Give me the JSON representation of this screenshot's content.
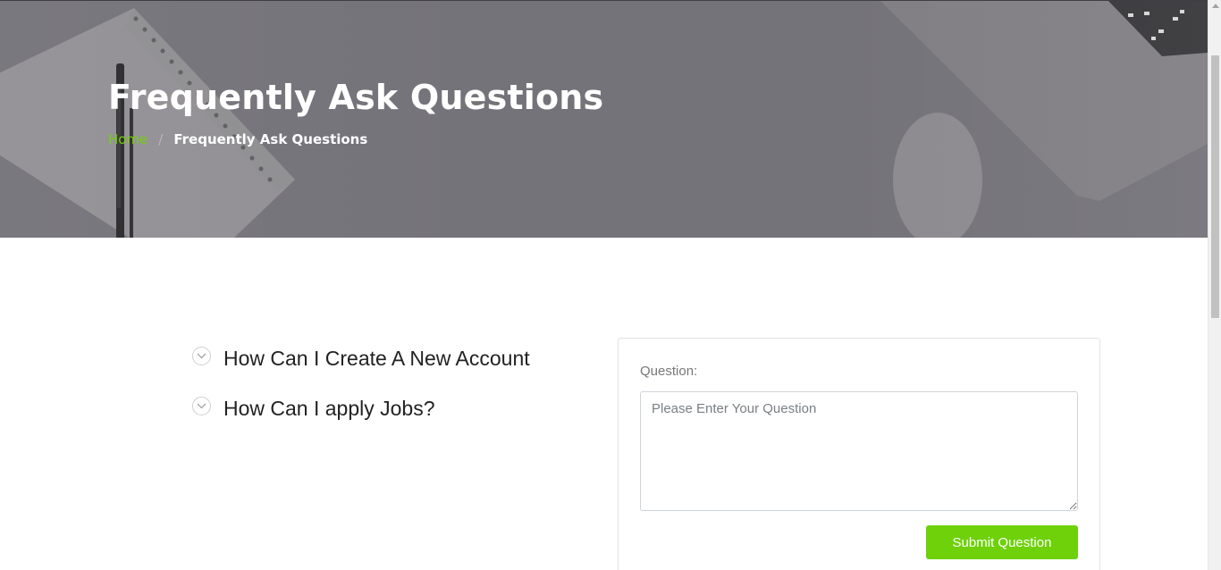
{
  "hero": {
    "title": "Frequently Ask Questions",
    "breadcrumb": {
      "home": "Home",
      "separator": "/",
      "current": "Frequently Ask Questions"
    }
  },
  "faq": {
    "items": [
      {
        "question": "How Can I Create A New Account",
        "icon": "chevron-down-icon"
      },
      {
        "question": "How Can I apply Jobs?",
        "icon": "chevron-down-icon"
      }
    ]
  },
  "form": {
    "label": "Question:",
    "placeholder": "Please Enter Your Question",
    "value": "",
    "submit_label": "Submit Question"
  },
  "colors": {
    "accent": "#6ed10a",
    "hero_overlay": "#75737a",
    "text_dark": "#222222"
  }
}
